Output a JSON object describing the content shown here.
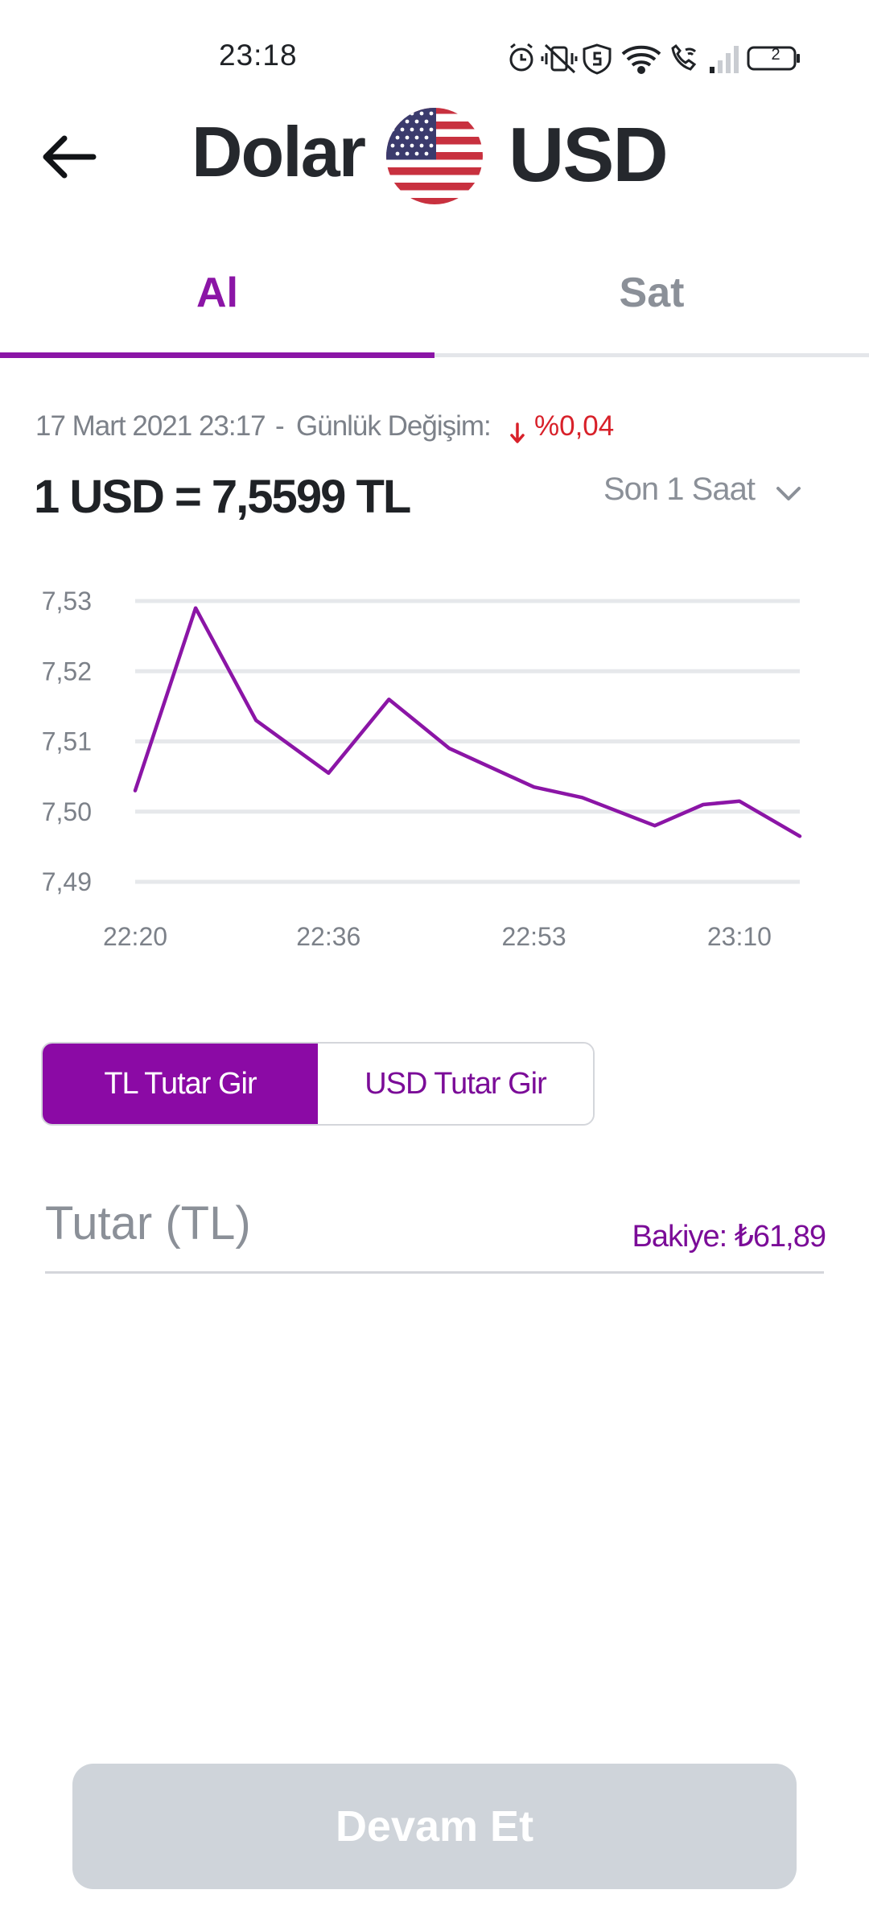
{
  "status_bar": {
    "time": "23:18",
    "battery": "2",
    "icons": [
      "alarm-icon",
      "vibrate-icon",
      "shield-icon",
      "wifi-icon",
      "wifi-calling-icon",
      "signal-icon",
      "battery-icon"
    ]
  },
  "header": {
    "back_icon": "arrow-left-icon",
    "name": "Dolar",
    "flag_icon": "us-flag-icon",
    "code": "USD"
  },
  "tabs": [
    {
      "label": "Al",
      "active": true
    },
    {
      "label": "Sat",
      "active": false
    }
  ],
  "rate": {
    "date": "17 Mart 2021 23:17",
    "separator": "-",
    "change_label": "Günlük Değişim:",
    "change_value": "%0,04",
    "change_direction": "down",
    "main": "1 USD = 7,5599 TL",
    "period": "Son 1 Saat"
  },
  "colors": {
    "accent": "#8b15a6",
    "negative": "#d8212a",
    "disabled_button": "#cfd4da"
  },
  "chart_data": {
    "type": "line",
    "title": "",
    "xlabel": "",
    "ylabel": "",
    "y_ticks": [
      "7,53",
      "7,52",
      "7,51",
      "7,50",
      "7,49"
    ],
    "y_tick_values": [
      7.53,
      7.52,
      7.51,
      7.5,
      7.49
    ],
    "ylim": [
      7.49,
      7.53
    ],
    "x_ticks": [
      "22:20",
      "22:36",
      "22:53",
      "23:10"
    ],
    "grid": true,
    "series": [
      {
        "color": "#8b15a6",
        "x": [
          "22:20",
          "22:25",
          "22:30",
          "22:36",
          "22:41",
          "22:46",
          "22:53",
          "22:57",
          "23:03",
          "23:07",
          "23:10",
          "23:15"
        ],
        "values": [
          7.503,
          7.529,
          7.513,
          7.5055,
          7.516,
          7.509,
          7.5035,
          7.502,
          7.498,
          7.501,
          7.5015,
          7.4965
        ]
      }
    ]
  },
  "entry": {
    "mode_options": [
      "TL Tutar Gir",
      "USD Tutar Gir"
    ],
    "selected_mode": "TL Tutar Gir",
    "amount_placeholder": "Tutar (TL)",
    "amount_value": "",
    "balance": "Bakiye: ₺61,89"
  },
  "continue_label": "Devam Et"
}
